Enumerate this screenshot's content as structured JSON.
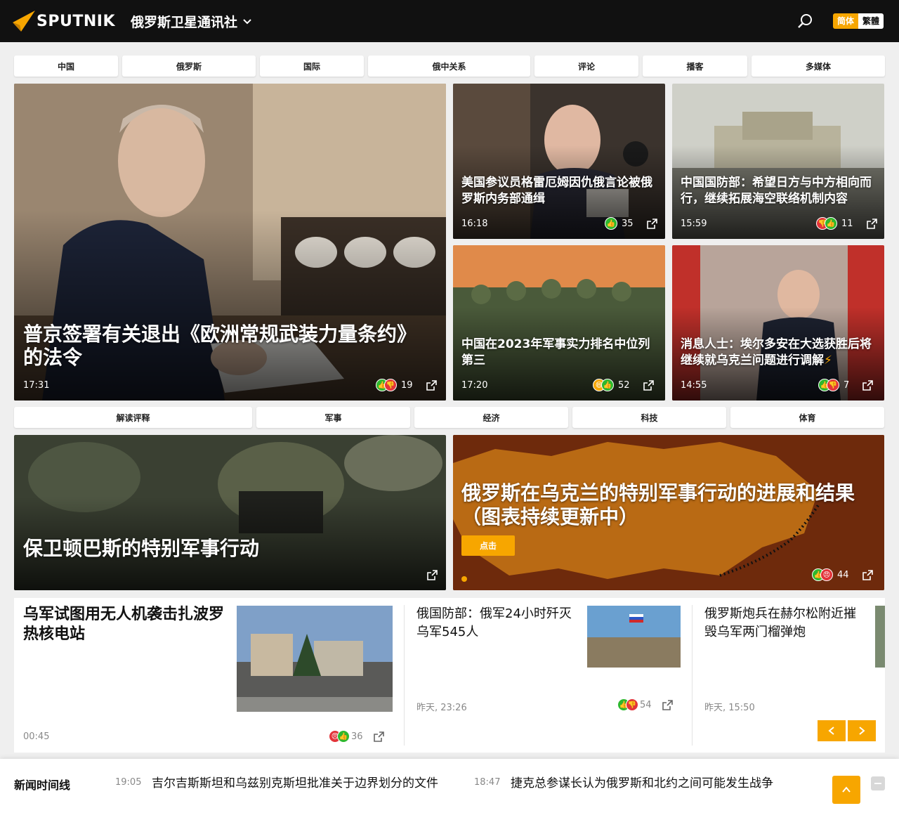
{
  "header": {
    "logo_text": "SPUTNIK",
    "site_title": "俄罗斯卫星通讯社",
    "lang_simplified": "简体",
    "lang_traditional": "繁體"
  },
  "nav_primary": [
    "中国",
    "俄罗斯",
    "国际",
    "俄中关系",
    "评论",
    "播客",
    "多媒体"
  ],
  "nav_secondary": [
    "解读评释",
    "军事",
    "经济",
    "科技",
    "体育"
  ],
  "featured": {
    "title": "普京签署有关退出《欧洲常规武装力量条约》的法令",
    "time": "17:31",
    "count": "19"
  },
  "cards": [
    {
      "title": "美国参议员格雷厄姆因仇俄言论被俄罗斯内务部通缉",
      "time": "16:18",
      "count": "35"
    },
    {
      "title": "中国国防部：希望日方与中方相向而行，继续拓展海空联络机制内容",
      "time": "15:59",
      "count": "11"
    },
    {
      "title": "中国在2023年军事实力排名中位列第三",
      "time": "17:20",
      "count": "52"
    },
    {
      "title": "消息人士：埃尔多安在大选获胜后将继续就乌克兰问题进行调解",
      "time": "14:55",
      "count": "7"
    }
  ],
  "promo_left": {
    "title": "保卫顿巴斯的特别军事行动"
  },
  "promo_right": {
    "title": "俄罗斯在乌克兰的特别军事行动的进展和结果（图表持续更新中）",
    "button": "点击",
    "count": "44"
  },
  "news": [
    {
      "title": "乌军试图用无人机袭击扎波罗热核电站",
      "time": "00:45",
      "count": "36"
    },
    {
      "title": "俄国防部：俄军24小时歼灭乌军545人",
      "time": "昨天, 23:26",
      "count": "54"
    },
    {
      "title": "俄罗斯炮兵在赫尔松附近摧毁乌军两门榴弹炮",
      "time": "昨天, 15:50"
    }
  ],
  "timeline": {
    "label": "新闻时间线",
    "items": [
      {
        "time": "19:05",
        "headline": "吉尔吉斯斯坦和乌兹别克斯坦批准关于边界划分的文件"
      },
      {
        "time": "18:47",
        "headline": "捷克总参谋长认为俄罗斯和北约之间可能发生战争"
      }
    ]
  },
  "colors": {
    "accent": "#f7a600",
    "header_bg": "#111111",
    "like": "#2eb82e",
    "dislike": "#e3343a"
  }
}
